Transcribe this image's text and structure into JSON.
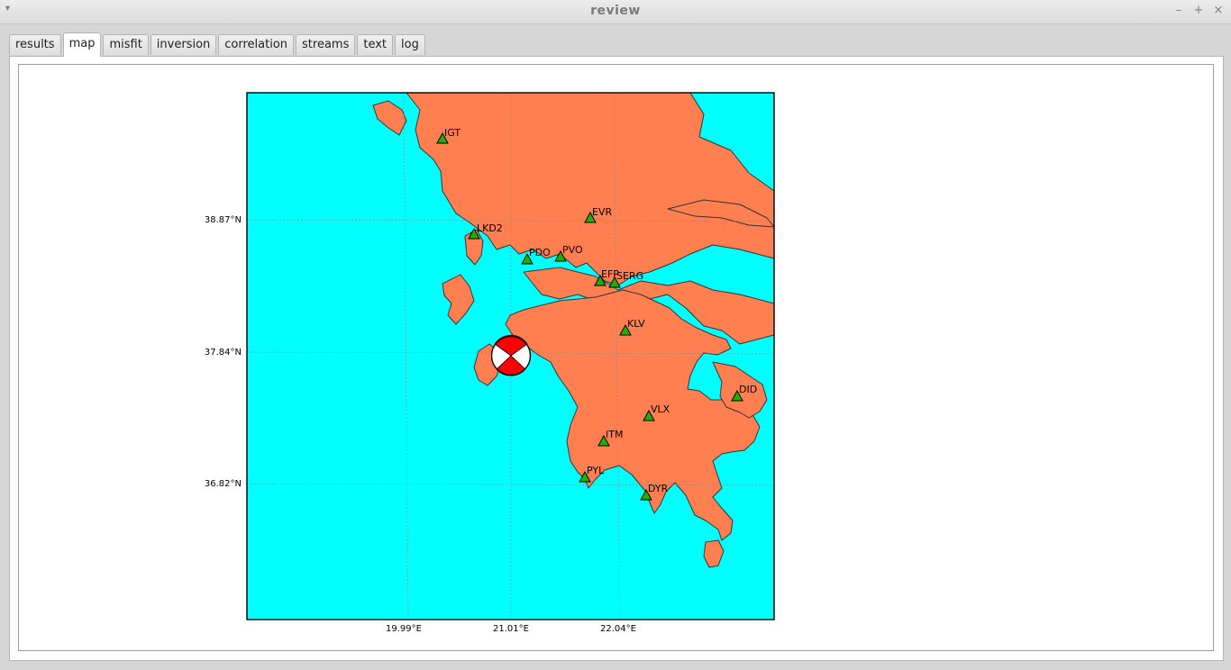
{
  "window": {
    "title": "review",
    "menu_glyph": "▾",
    "minimize": "–",
    "maximize": "+",
    "close": "×"
  },
  "tabs": [
    {
      "label": "results",
      "active": false
    },
    {
      "label": "map",
      "active": true
    },
    {
      "label": "misfit",
      "active": false
    },
    {
      "label": "inversion",
      "active": false
    },
    {
      "label": "correlation",
      "active": false
    },
    {
      "label": "streams",
      "active": false
    },
    {
      "label": "text",
      "active": false
    },
    {
      "label": "log",
      "active": false
    }
  ],
  "map": {
    "colors": {
      "sea": "#00ffff",
      "land": "#ff7f50",
      "station": "#1fb000",
      "beachball": "#ff0000"
    },
    "lat_labels": [
      "38.87°N",
      "37.84°N",
      "36.82°N"
    ],
    "lon_labels": [
      "19.99°E",
      "21.01°E",
      "22.04°E"
    ],
    "stations": [
      "IGT",
      "EVR",
      "LKD2",
      "PDO",
      "PVO",
      "EFP",
      "SERG",
      "KLV",
      "DID",
      "VLX",
      "ITM",
      "PYL",
      "DYR"
    ]
  }
}
